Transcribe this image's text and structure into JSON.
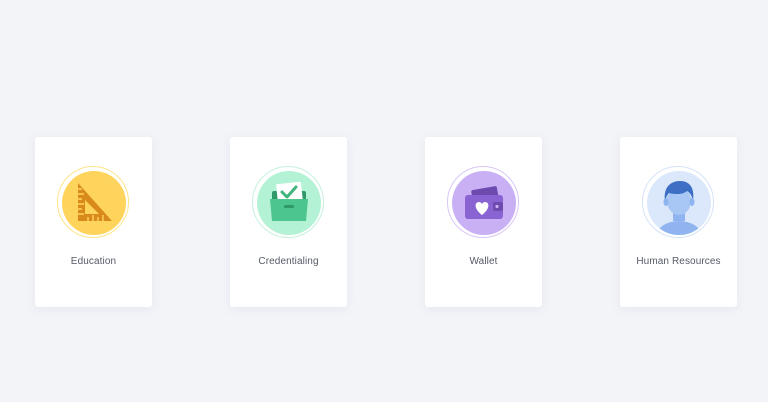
{
  "colors": {
    "page_background": "#f3f4f8",
    "card_background": "#ffffff",
    "label_text": "#555a66"
  },
  "cards": [
    {
      "label": "Education",
      "icon": "set-square-ruler-icon",
      "ring_color": "#fde58a",
      "fill_color": "#ffd45c",
      "accent_color": "#d88a1a"
    },
    {
      "label": "Credentialing",
      "icon": "checked-folder-icon",
      "ring_color": "#c7f0dc",
      "fill_color": "#b3f2d4",
      "accent_color": "#3fb37c"
    },
    {
      "label": "Wallet",
      "icon": "wallet-heart-icon",
      "ring_color": "#d8c7f5",
      "fill_color": "#c9b0f5",
      "accent_color": "#8a63d2"
    },
    {
      "label": "Human Resources",
      "icon": "person-head-icon",
      "ring_color": "#d6e4f8",
      "fill_color": "#dbe8fb",
      "accent_color": "#3d6fc4"
    }
  ]
}
